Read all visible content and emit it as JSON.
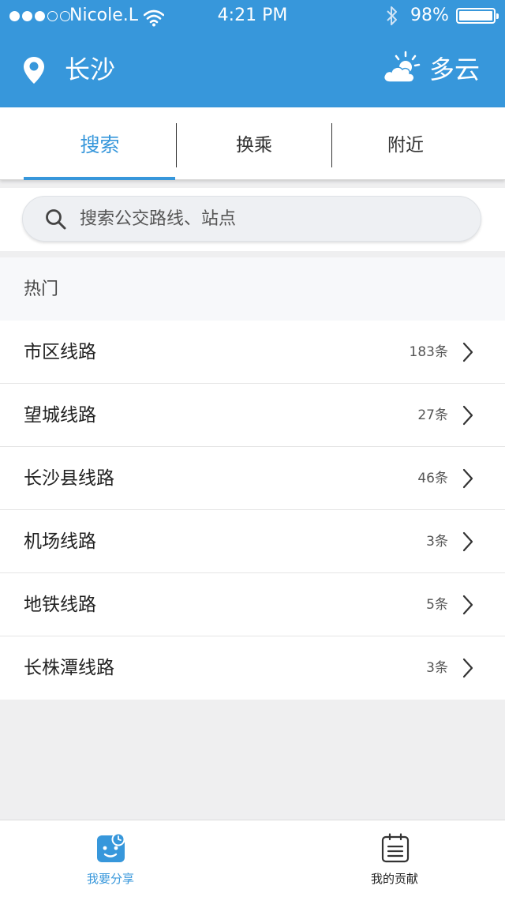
{
  "status_bar": {
    "carrier": "Nicole.L",
    "time": "4:21 PM",
    "battery": "98%",
    "signal_bars_filled": 3,
    "signal_bars_total": 5
  },
  "header": {
    "city": "长沙",
    "weather": "多云",
    "location_icon": "location-pin-icon",
    "weather_icon": "partly-cloudy-icon"
  },
  "tabs": [
    {
      "label": "搜索",
      "active": true
    },
    {
      "label": "换乘",
      "active": false
    },
    {
      "label": "附近",
      "active": false
    }
  ],
  "search": {
    "placeholder": "搜索公交路线、站点",
    "icon": "search-icon"
  },
  "hot": {
    "title": "热门",
    "items": [
      {
        "label": "市区线路",
        "count": "183条"
      },
      {
        "label": "望城线路",
        "count": "27条"
      },
      {
        "label": "长沙县线路",
        "count": "46条"
      },
      {
        "label": "机场线路",
        "count": "3条"
      },
      {
        "label": "地铁线路",
        "count": "5条"
      },
      {
        "label": "长株潭线路",
        "count": "3条"
      }
    ]
  },
  "tabbar": {
    "share_label": "我要分享",
    "contrib_label": "我的贡献"
  },
  "colors": {
    "accent": "#3797db",
    "background": "#efeff0"
  }
}
